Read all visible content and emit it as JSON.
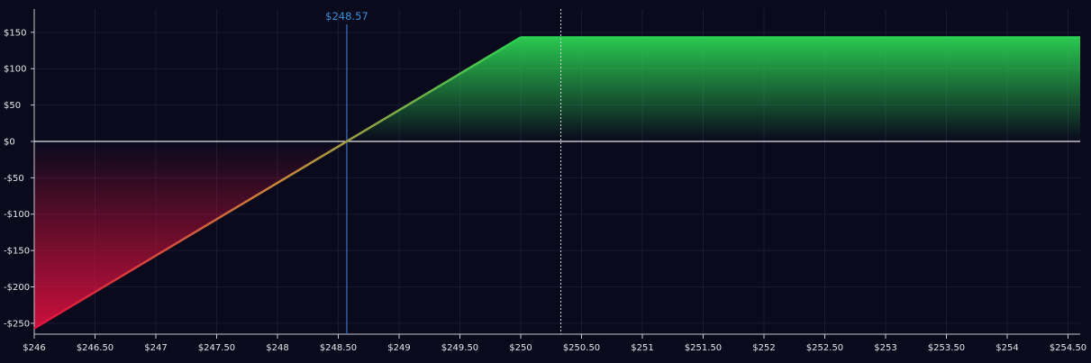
{
  "chart_data": {
    "type": "area",
    "x": [
      246,
      248.57,
      250,
      254.5
    ],
    "series": [
      {
        "values": [
          -257,
          0,
          143,
          143
        ]
      }
    ],
    "xlim": [
      246,
      254.6
    ],
    "ylim": [
      -265,
      182
    ],
    "x_ticks": [
      246,
      246.5,
      247,
      247.5,
      248,
      248.5,
      249,
      249.5,
      250,
      250.5,
      251,
      251.5,
      252,
      252.5,
      253,
      253.5,
      254,
      254.5
    ],
    "x_tick_labels": [
      "$246",
      "$246.50",
      "$247",
      "$247.50",
      "$248",
      "$248.50",
      "$249",
      "$249.50",
      "$250",
      "$250.50",
      "$251",
      "$251.50",
      "$252",
      "$252.50",
      "$253",
      "$253.50",
      "$254",
      "$254.50"
    ],
    "y_ticks": [
      150,
      100,
      50,
      0,
      -50,
      -100,
      -150,
      -200,
      -250
    ],
    "y_tick_labels": [
      "$150",
      "$100",
      "$50",
      "$0",
      "-$50",
      "-$100",
      "-$150",
      "-$200",
      "-$250"
    ],
    "breakeven": {
      "x": 248.57,
      "label": "$248.57"
    },
    "current_price_x": 250.33,
    "grid": true,
    "colors": {
      "background": "#0a0a1c",
      "profit": "#2bd152",
      "loss": "#e0103f",
      "breakeven_line": "#3a72c8",
      "breakeven_label": "#3a8fd8",
      "zero_line": "#e6e6ea",
      "grid": "#1a1a30",
      "axis": "#c8c8d0"
    }
  }
}
